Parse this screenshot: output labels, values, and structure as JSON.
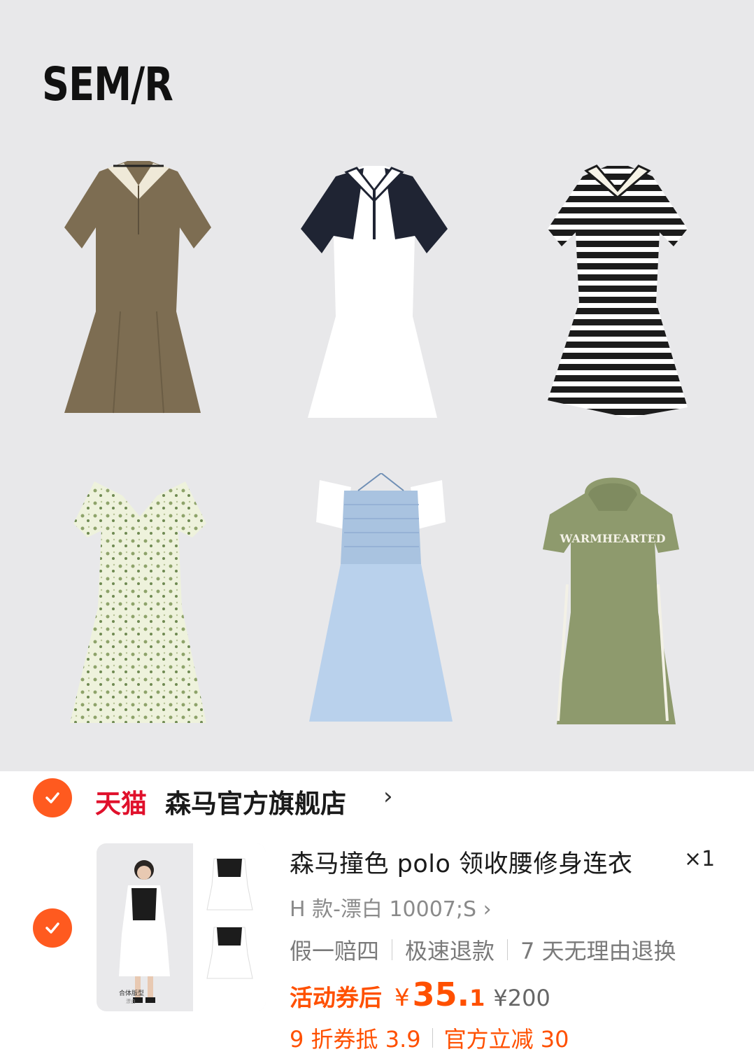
{
  "brand": {
    "logo_text": "SEM/R"
  },
  "shop": {
    "platform_label": "天猫",
    "name": "森马官方旗舰店",
    "chevron": "›"
  },
  "product": {
    "title": "森马撞色 polo 领收腰修身连衣",
    "quantity": "×1",
    "variant": "H 款-漂白 10007;S ›",
    "tags": [
      "假一赔四",
      "极速退款",
      "7 天无理由退换"
    ],
    "promo_label": "活动券后",
    "currency": "¥",
    "price_int": "35.",
    "price_dec": "1",
    "original_price": "¥200",
    "coupons": [
      "9 折券抵 3.9",
      "官方立减 30"
    ],
    "thumb_caption": "合体版型",
    "thumb_subcaption": "漂白"
  },
  "colors": {
    "accent_orange": "#ff5000",
    "check_orange": "#ff5a1f",
    "tmall_red": "#e0102b",
    "banner_bg": "#e8e8ea"
  },
  "icons": {
    "check": "check-icon",
    "chevron": "chevron-right-icon"
  }
}
